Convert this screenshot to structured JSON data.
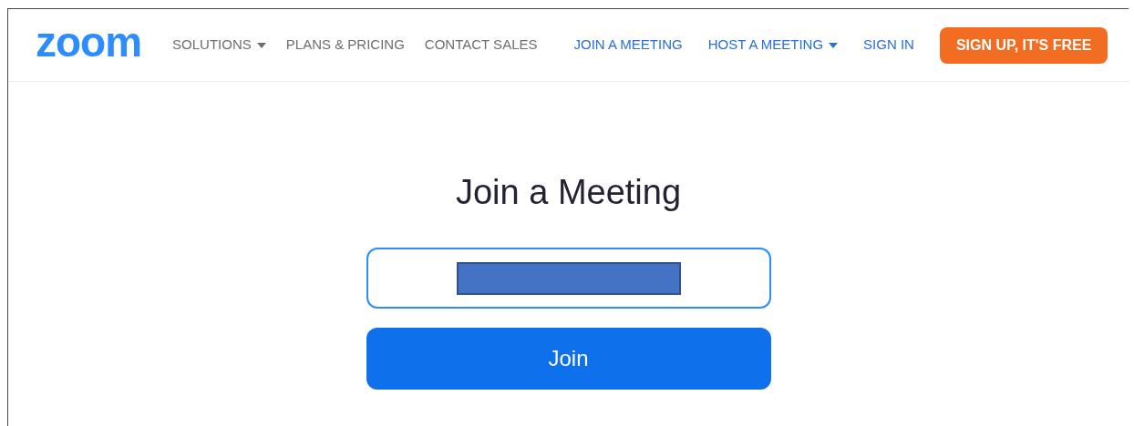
{
  "logo": "zoom",
  "nav_left": [
    {
      "label": "SOLUTIONS",
      "dropdown": true
    },
    {
      "label": "PLANS & PRICING",
      "dropdown": false
    },
    {
      "label": "CONTACT SALES",
      "dropdown": false
    }
  ],
  "nav_right": [
    {
      "label": "JOIN A MEETING",
      "dropdown": false
    },
    {
      "label": "HOST A MEETING",
      "dropdown": true
    },
    {
      "label": "SIGN IN",
      "dropdown": false
    }
  ],
  "signup_button": "SIGN UP, IT'S FREE",
  "heading": "Join a Meeting",
  "meeting_field": {
    "redacted": true
  },
  "join_button": "Join"
}
